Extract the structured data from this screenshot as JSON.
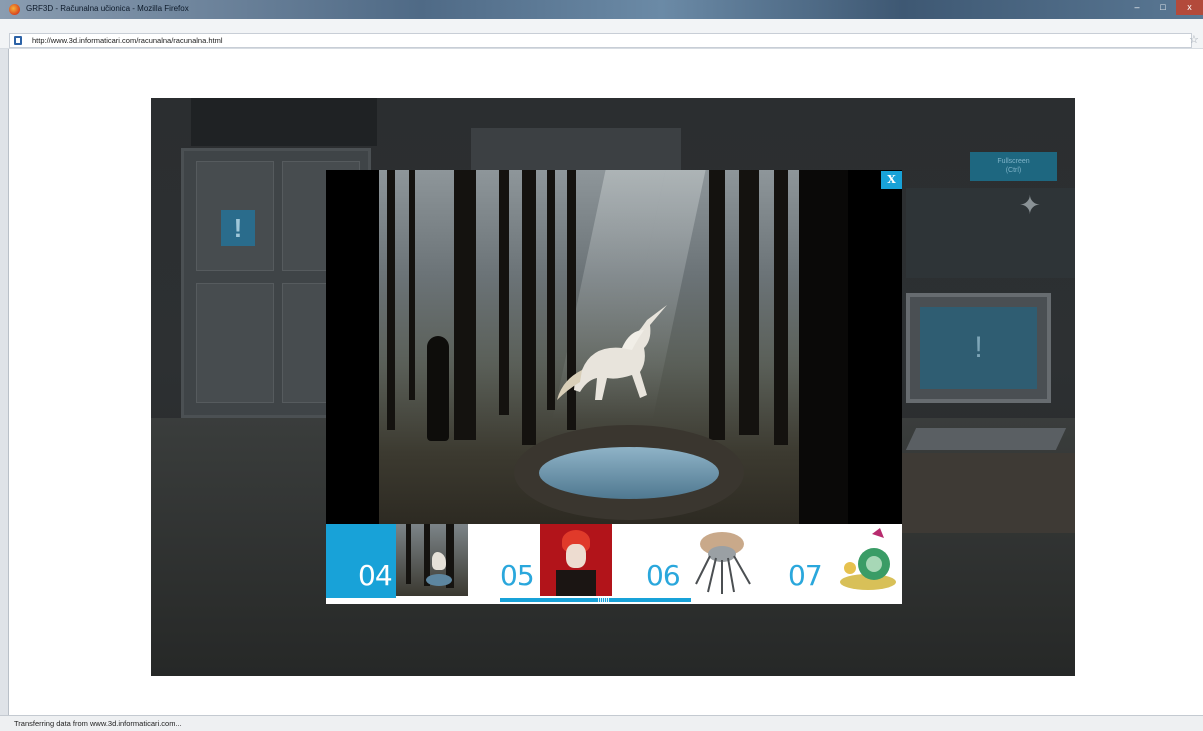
{
  "window": {
    "title": "GRF3D - Računalna učionica - Mozilla Firefox",
    "minimize_icon": "minimize-icon",
    "maximize_icon": "maximize-icon",
    "close_icon": "close-icon"
  },
  "address_bar": {
    "url": "http://www.3d.informaticari.com/racunalna/racunalna.html",
    "bookmark_icon": "star-icon"
  },
  "scene": {
    "fullscreen_label_line1": "Fullscreen",
    "fullscreen_label_line2": "(Ctrl)"
  },
  "lightbox": {
    "close_label": "X",
    "thumbnails": [
      {
        "number": "04",
        "active": true
      },
      {
        "number": "05",
        "active": false
      },
      {
        "number": "06",
        "active": false
      },
      {
        "number": "07",
        "active": false
      }
    ]
  },
  "status_bar": {
    "text": "Transferring data from www.3d.informaticari.com..."
  },
  "colors": {
    "accent": "#18a2d8",
    "number_text": "#2aa7dc"
  }
}
